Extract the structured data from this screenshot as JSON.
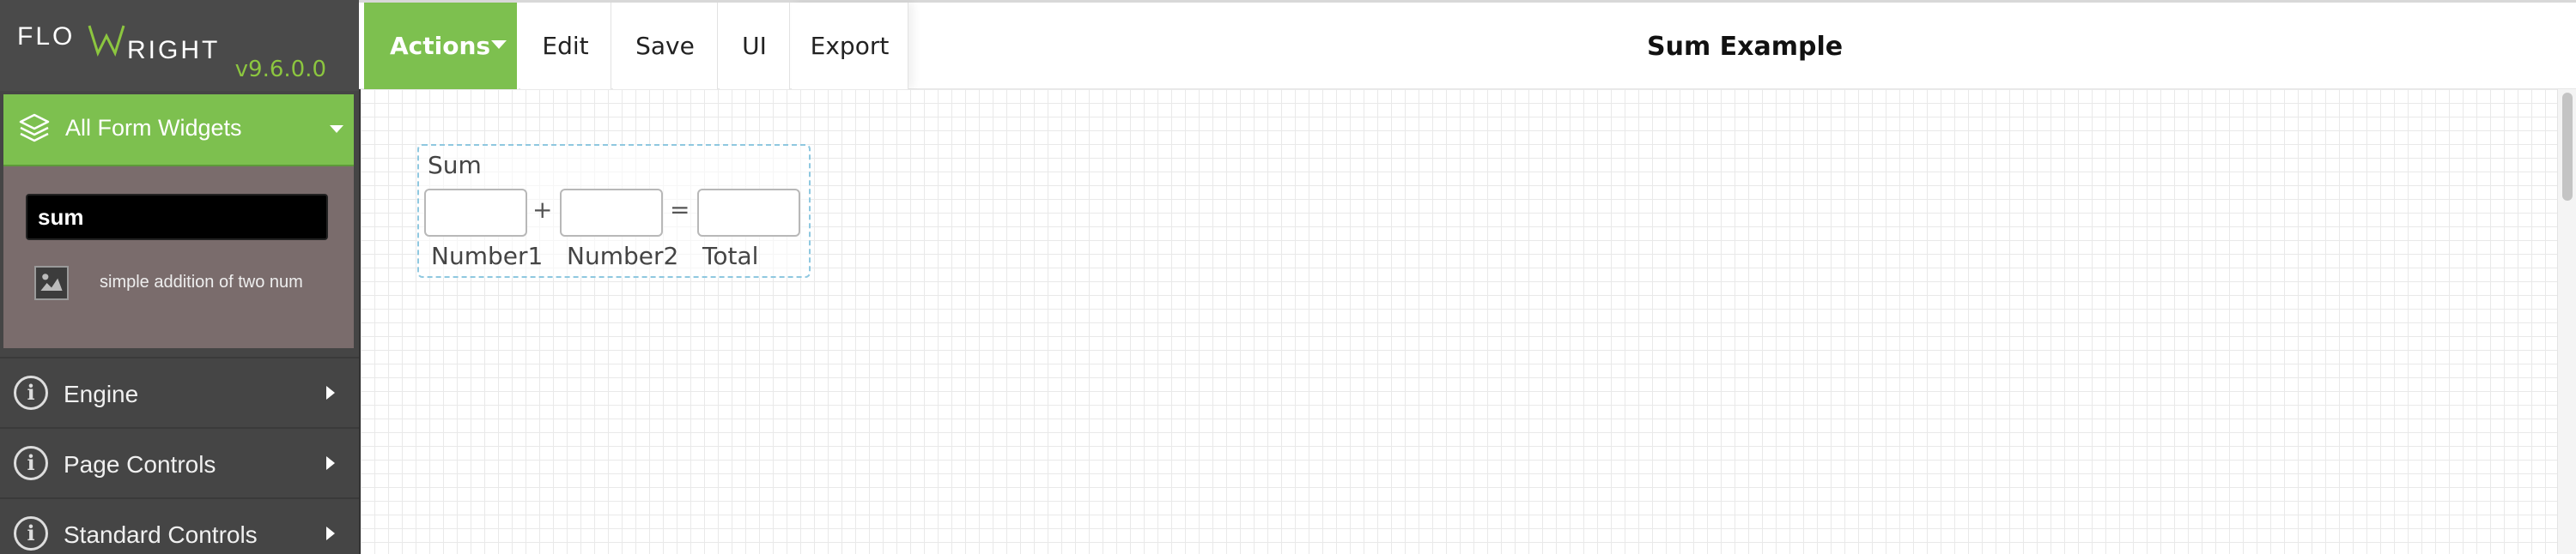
{
  "brand": {
    "name": "FLOWRIGHT",
    "version": "v9.6.0.0"
  },
  "colors": {
    "accent": "#7dc04f",
    "sidebar": "#454545",
    "panel": "#7a6c6c"
  },
  "sidebar": {
    "widgets_panel": {
      "title": "All Form Widgets",
      "icon": "layers-icon",
      "search_value": "sum",
      "results": [
        {
          "description": "simple addition of two num",
          "icon": "widget-thumbnail-icon"
        }
      ]
    },
    "items": [
      {
        "label": "Engine",
        "icon": "info-icon"
      },
      {
        "label": "Page Controls",
        "icon": "info-icon"
      },
      {
        "label": "Standard Controls",
        "icon": "info-icon"
      }
    ]
  },
  "toolbar": {
    "actions_label": "Actions",
    "edit_label": "Edit",
    "save_label": "Save",
    "ui_label": "UI",
    "export_label": "Export"
  },
  "page": {
    "title": "Sum Example"
  },
  "canvas": {
    "sum_widget": {
      "caption": "Sum",
      "plus": "+",
      "equals": "=",
      "number1_label": "Number1",
      "number2_label": "Number2",
      "total_label": "Total"
    }
  }
}
